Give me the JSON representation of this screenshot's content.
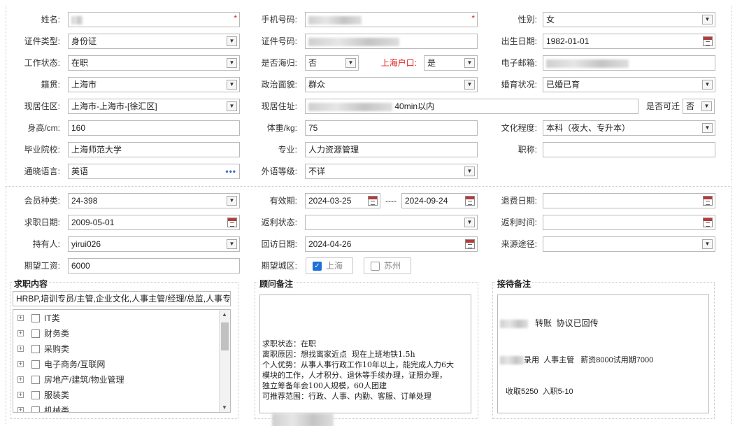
{
  "basic": {
    "name_label": "姓名:",
    "mobile_label": "手机号码:",
    "gender_label": "性别:",
    "gender_value": "女",
    "idtype_label": "证件类型:",
    "idtype_value": "身份证",
    "idno_label": "证件号码:",
    "birth_label": "出生日期:",
    "birth_value": "1982-01-01",
    "workstatus_label": "工作状态:",
    "workstatus_value": "在职",
    "returnee_label": "是否海归:",
    "returnee_value": "否",
    "shhukou_label": "上海户口:",
    "shhukou_value": "是",
    "email_label": "电子邮箱:",
    "native_label": "籍贯:",
    "native_value": "上海市",
    "political_label": "政治面貌:",
    "political_value": "群众",
    "marital_label": "婚育状况:",
    "marital_value": "已婚已育",
    "residence_label": "现居住区:",
    "residence_value": "上海市-上海市-[徐汇区]",
    "address_label": "现居住址:",
    "address_value": "40min以内",
    "relocate_label": "是否可迁",
    "relocate_value": "否",
    "height_label": "身高/cm:",
    "height_value": "160",
    "weight_label": "体重/kg:",
    "weight_value": "75",
    "education_label": "文化程度:",
    "education_value": "本科（夜大、专升本）",
    "school_label": "毕业院校:",
    "school_value": "上海师范大学",
    "major_label": "专业:",
    "major_value": "人力资源管理",
    "title_label": "职称:",
    "title_value": "",
    "language_label": "通晓语言:",
    "language_value": "英语",
    "langlevel_label": "外语等级:",
    "langlevel_value": "不详"
  },
  "member": {
    "type_label": "会员种类:",
    "type_value": "24-398",
    "valid_label": "有效期:",
    "valid_from": "2024-03-25",
    "valid_sep": "----",
    "valid_to": "2024-09-24",
    "refund_label": "退费日期:",
    "refund_value": "",
    "jobdate_label": "求职日期:",
    "jobdate_value": "2009-05-01",
    "rebate_label": "返利状态:",
    "rebate_value": "",
    "rebatetime_label": "返利时间:",
    "rebatetime_value": "",
    "holder_label": "持有人:",
    "holder_value": "yirui026",
    "revisit_label": "回访日期:",
    "revisit_value": "2024-04-26",
    "source_label": "来源途径:",
    "source_value": "",
    "salary_label": "期望工资:",
    "salary_value": "6000",
    "city_label": "期望城区:",
    "city_options": [
      "上海",
      "苏州"
    ]
  },
  "jobs": {
    "heading": "求职内容",
    "summary": "HRBP,培训专员/主管,企业文化,人事主管/经理/总监,人事专",
    "categories": [
      "IT类",
      "财务类",
      "采购类",
      "电子商务/互联网",
      "房地产/建筑/物业管理",
      "服装类",
      "机械类"
    ]
  },
  "consultant": {
    "heading": "顾问备注",
    "text": "求职状态：在职\n离职原因：想找离家近点  现在上班地铁1.5h\n个人优势：从事人事行政工作10年以上，能完成人力6大\n模块的工作，人才积分、退休等手续办理，证照办理，\n独立筹备年会100人规模，60人团建\n可推荐范围：行政、人事、内勤、客服、订单处理"
  },
  "reception": {
    "heading": "接待备注",
    "line1": "转账  协议已回传",
    "line2": "录用  人事主管   薪资8000试用期7000",
    "line3": "收取5250  入职5-10"
  },
  "icons": {
    "dropdown": "chevron-down-icon",
    "calendar": "calendar-icon",
    "ellipsis": "more-icon",
    "check": "checkmark-icon",
    "expand": "plus-expand-icon"
  },
  "colors": {
    "required": "#e02020",
    "checkbox_checked": "#1e6fd9",
    "link_dots": "#3a6fbf"
  }
}
